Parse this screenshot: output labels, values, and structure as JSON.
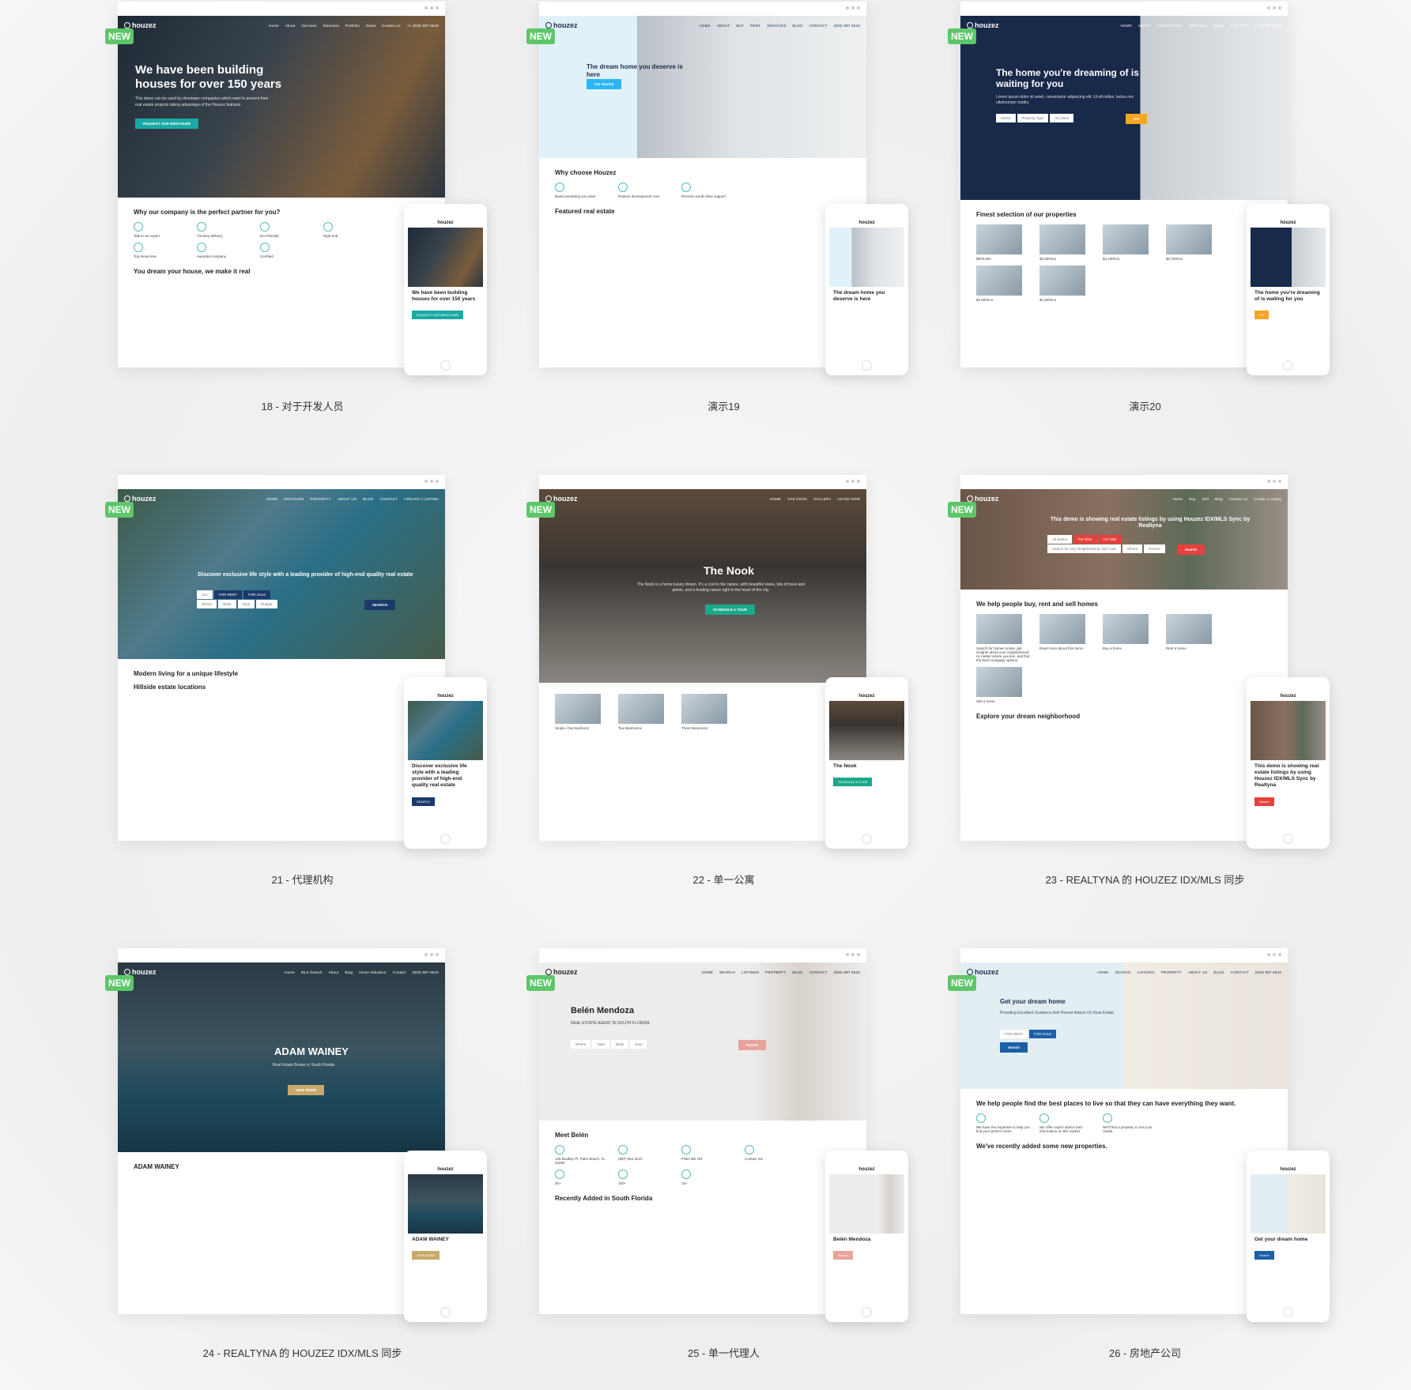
{
  "badge": "NEW",
  "colors": {
    "badge": "#5ec66a",
    "background": "#efefef"
  },
  "demos": [
    {
      "caption": "18 - 对于开发人员",
      "logo": "houzez",
      "nav": [
        "Home",
        "About",
        "Services",
        "Solutions",
        "Portfolio",
        "News",
        "Contact us"
      ],
      "phone": "+1 (800) 987 6543",
      "headline": "We have been building houses for over 150 years",
      "sub": "This demo can be used by developer companies which want to present their real estate projects taking advantage of the Houzez features",
      "button": "REQUEST OUR BROCHURE",
      "sections": [
        {
          "title": "Why our company is the perfect partner for you?",
          "items": [
            "Talk to an expert",
            "Turnkey delivery",
            "Eco-friendly",
            "High-end",
            "Top know-how",
            "Awarded company",
            "Certified"
          ]
        },
        {
          "title": "You dream your house, we make it real",
          "items": []
        }
      ],
      "mobile": {
        "title": "We have been building houses for over 150 years",
        "button": "REQUEST OUR BROCHURE"
      },
      "theme": {
        "hero": "linear-gradient(120deg,#1e2a36 0%,#39434c 40%,#7a5c3c 75%,#2b3540 100%)",
        "text": "#ffffff",
        "accent": "#1aa9a5"
      }
    },
    {
      "caption": "演示19",
      "logo": "houzez",
      "nav": [
        "HOME",
        "ABOUT",
        "BUY",
        "RENT",
        "SERVICES",
        "BLOG",
        "CONTACT"
      ],
      "phone": "(800) 987 6543",
      "headline": "The dream home you deserve is here",
      "sub": "",
      "button": "Get Started",
      "sections": [
        {
          "title": "Why choose Houzez",
          "items": [
            "Build everything you want",
            "Reduce development cost",
            "Receive world class support"
          ]
        },
        {
          "title": "Featured real estate",
          "items": []
        }
      ],
      "mobile": {
        "title": "The dream home you deserve is here",
        "button": ""
      },
      "theme": {
        "hero": "linear-gradient(90deg,#e1f1fa 0%,#e1f1fa 30%,#b9c0c6 30%,#dfe3e6 60%,#eef0f1 100%)",
        "text": "#1b2b4b",
        "accent": "#29b6f6"
      }
    },
    {
      "caption": "演示20",
      "logo": "houzez",
      "nav": [
        "HOME",
        "ABOUT",
        "PROPERTIES",
        "SERVICES",
        "BLOG",
        "CONTACT"
      ],
      "phone": "(800) 987 6543",
      "headline": "The home you're dreaming of is waiting for you",
      "sub": "Lorem ipsum dolor sit amet, consectetur adipiscing elit. Ut elit tellus, luctus nec ullamcorper mattis.",
      "button": "GO",
      "fields": [
        "Select",
        "Property Type",
        "All Cities"
      ],
      "sections": [
        {
          "title": "Finest selection of our properties",
          "items": [
            "$876,000",
            "$3,500/mo",
            "$4,100/mo",
            "$3,700/mo",
            "$2,600/mo",
            "$1,600/mo"
          ]
        }
      ],
      "mobile": {
        "title": "The home you're dreaming of is waiting for you",
        "button": "GO"
      },
      "theme": {
        "hero": "linear-gradient(90deg,#18294a 0%,#18294a 55%,#c7cdd2 55%,#e8eaec 100%)",
        "text": "#ffffff",
        "accent": "#f6a623"
      }
    },
    {
      "caption": "21 - 代理机构",
      "logo": "houzez",
      "nav": [
        "HOME",
        "DISCOVER",
        "PROPERTY",
        "ABOUT US",
        "BLOG",
        "CONTACT"
      ],
      "phone": "CREATE A LISTING",
      "headline": "Discover exclusive life style with a leading provider of high-end quality real estate",
      "sub": "",
      "button": "SEARCH",
      "tabs": [
        "ALL",
        "FOR RENT",
        "FOR SALE"
      ],
      "fields": [
        "Where",
        "Beds",
        "Type",
        "Budget"
      ],
      "sections": [
        {
          "title": "Modern living for a unique lifestyle",
          "items": []
        },
        {
          "title": "Hillside estate locations",
          "items": []
        }
      ],
      "mobile": {
        "title": "Discover exclusive life style with a leading provider of high-end quality real estate",
        "button": "SEARCH"
      },
      "theme": {
        "hero": "linear-gradient(135deg,#3d5a4a 0%,#4f7a8a 35%,#2a6f86 55%,#465c4a 100%)",
        "text": "#ffffff",
        "accent": "#1b3a6b"
      }
    },
    {
      "caption": "22 - 单一公寓",
      "logo": "houzez",
      "nav": [
        "HOME",
        "THE NOOK",
        "GALLERY",
        "LEASE NOW"
      ],
      "phone": "",
      "headline": "The Nook",
      "sub": "The Nook is a home luxury dream. It's a cool in the nature, with beautiful views, lots of trees and plants, and a healing nature right in the heart of the city.",
      "button": "SCHEDULE A TOUR",
      "sections": [
        {
          "title": "",
          "items": [
            "Studio, One Bedroom",
            "Two Bedrooms",
            "Three Bedrooms"
          ]
        }
      ],
      "mobile": {
        "title": "The Nook",
        "button": "SCHEDULE A TOUR"
      },
      "theme": {
        "hero": "linear-gradient(180deg,#5a4a3c 0%,#3a3430 40%,#6a6660 75%,#8a8580 100%)",
        "text": "#ffffff",
        "accent": "#1aa98a"
      }
    },
    {
      "caption": "23 - REALTYNA 的 HOUZEZ IDX/MLS 同步",
      "logo": "houzez",
      "nav": [
        "Home",
        "Buy",
        "Sell",
        "Blog",
        "Contact us"
      ],
      "phone": "Create a Listing",
      "headline": "This demo is showing real estate listings by using Houzez IDX/MLS Sync by Realtyna",
      "sub": "",
      "button": "Search",
      "tabs": [
        "All Status",
        "For Rent",
        "For Sale"
      ],
      "fields": [
        "Search for City, Neighborhood, Zip Code",
        "Where",
        "Rooms"
      ],
      "sections": [
        {
          "title": "We help people buy, rent and sell homes",
          "items": [
            "Search for homes online, get insights about your neighborhood no matter where you live, and find the best mortgage options.",
            "Read more about this demo",
            "Buy a home",
            "Rent a home",
            "Sell a home"
          ]
        },
        {
          "title": "Explore your dream neighborhood",
          "items": []
        }
      ],
      "mobile": {
        "title": "This demo is showing real estate listings by using Houzez IDX/MLS Sync by Realtyna",
        "button": "Search"
      },
      "theme": {
        "hero": "linear-gradient(90deg,#6a5548 0%,#8a7060 45%,#5d6a58 70%,#9a8e86 100%)",
        "text": "#ffffff",
        "accent": "#e5413d"
      }
    },
    {
      "caption": "24 - REALTYNA 的 HOUZEZ IDX/MLS 同步",
      "logo": "houzez",
      "nav": [
        "Home",
        "MLS Search",
        "About",
        "Blog",
        "Home Valuation",
        "Contact"
      ],
      "phone": "(800) 987 6543",
      "headline": "ADAM WAINEY",
      "sub": "Real Estate Broker in South Florida",
      "button": "VIEW MORE",
      "sections": [
        {
          "title": "ADAM WAINEY",
          "items": []
        }
      ],
      "mobile": {
        "title": "ADAM WAINEY",
        "button": "VIEW MORE"
      },
      "theme": {
        "hero": "linear-gradient(180deg,#2a3a44 0%,#3c5460 45%,#1e4a5c 70%,#173646 100%)",
        "text": "#ffffff",
        "accent": "#c8a96a"
      }
    },
    {
      "caption": "25 - 单一代理人",
      "logo": "houzez",
      "nav": [
        "HOME",
        "SEARCH",
        "LISTINGS",
        "PROPERTY",
        "BLOG",
        "CONTACT"
      ],
      "phone": "(800) 987 6543",
      "headline": "Belén Mendoza",
      "sub": "REAL ESTATE AGENT IN SOUTH FLORIDA",
      "button": "Search",
      "fields": [
        "Where",
        "Type",
        "Beds",
        "Size"
      ],
      "sections": [
        {
          "title": "Meet Belén",
          "items": [
            "125 Bradley Pl, Palm Beach, FL 33480",
            "(987) 654 3210",
            "FIND ME ON",
            "Contact me",
            "20+",
            "100+",
            "15+"
          ]
        },
        {
          "title": "Recently Added in South Florida",
          "items": []
        }
      ],
      "mobile": {
        "title": "Belén Mendoza",
        "button": "Search"
      },
      "theme": {
        "hero": "linear-gradient(90deg,#ededed 0%,#ececec 65%,#d8d2cc 80%,#ececec 100%)",
        "text": "#222222",
        "accent": "#e8a49b"
      }
    },
    {
      "caption": "26 - 房地产公司",
      "logo": "houzez",
      "nav": [
        "HOME",
        "SEARCH",
        "LISTINGS",
        "PROPERTY",
        "ABOUT US",
        "BLOG",
        "CONTACT"
      ],
      "phone": "(800) 987 6543",
      "headline": "Get your dream home",
      "sub": "Providing Excellent Guidance And Honest Advice On Real Estate",
      "button": "Search",
      "tabs": [
        "FOR RENT",
        "FOR SALE"
      ],
      "sections": [
        {
          "title": "We help people find the best places to live so that they can have everything they want.",
          "items": [
            "We have the expertise to help you find your perfect home",
            "We offer expert advice and information on the market.",
            "We'll find a property to suit your needs."
          ]
        },
        {
          "title": "We've recently added some new properties.",
          "items": []
        }
      ],
      "mobile": {
        "title": "Get your dream home",
        "button": "Search"
      },
      "theme": {
        "hero": "linear-gradient(90deg,#e3eef3 0%,#e3eef3 50%,#f1ece4 50%,#e9e4dc 100%)",
        "text": "#1b2b4b",
        "accent": "#1b5fa8"
      }
    }
  ]
}
